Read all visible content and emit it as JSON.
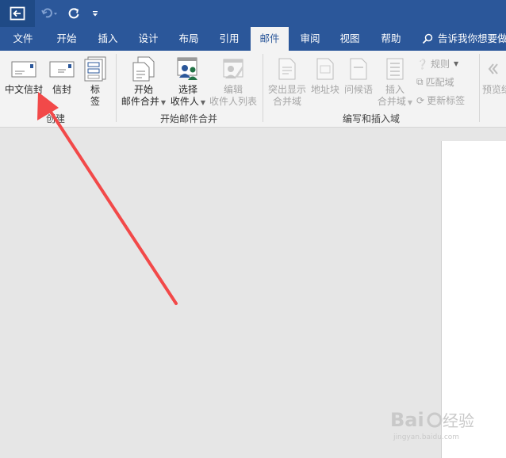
{
  "quick_access": {
    "back_icon": "back-arrow-icon",
    "undo_icon": "undo-icon",
    "redo_icon": "redo-icon",
    "more_icon": "customize-caret-icon"
  },
  "tabs": [
    {
      "label": "文件"
    },
    {
      "label": "开始"
    },
    {
      "label": "插入"
    },
    {
      "label": "设计"
    },
    {
      "label": "布局"
    },
    {
      "label": "引用"
    },
    {
      "label": "邮件",
      "active": true
    },
    {
      "label": "审阅"
    },
    {
      "label": "视图"
    },
    {
      "label": "帮助"
    }
  ],
  "tell_me": "告诉我你想要做",
  "groups": {
    "create": {
      "label": "创建",
      "envelope_cn": "中文信封",
      "envelope": "信封",
      "labels_l1": "标",
      "labels_l2": "签"
    },
    "start": {
      "label": "开始邮件合并",
      "start_l1": "开始",
      "start_l2": "邮件合并",
      "select_l1": "选择",
      "select_l2": "收件人",
      "edit_l1": "编辑",
      "edit_l2": "收件人列表"
    },
    "write": {
      "label": "编写和插入域",
      "highlight_l1": "突出显示",
      "highlight_l2": "合并域",
      "address": "地址块",
      "greeting": "问候语",
      "insert_l1": "插入",
      "insert_l2": "合并域",
      "rules": "规则",
      "match": "匹配域",
      "update": "更新标签"
    },
    "preview": {
      "label": "预览结"
    }
  },
  "watermark": {
    "brand": "Bai",
    "brand2": "du",
    "suffix": "经验",
    "url": "jingyan.baidu.com"
  },
  "colors": {
    "accent": "#2b579a",
    "arrow": "#f24949"
  }
}
